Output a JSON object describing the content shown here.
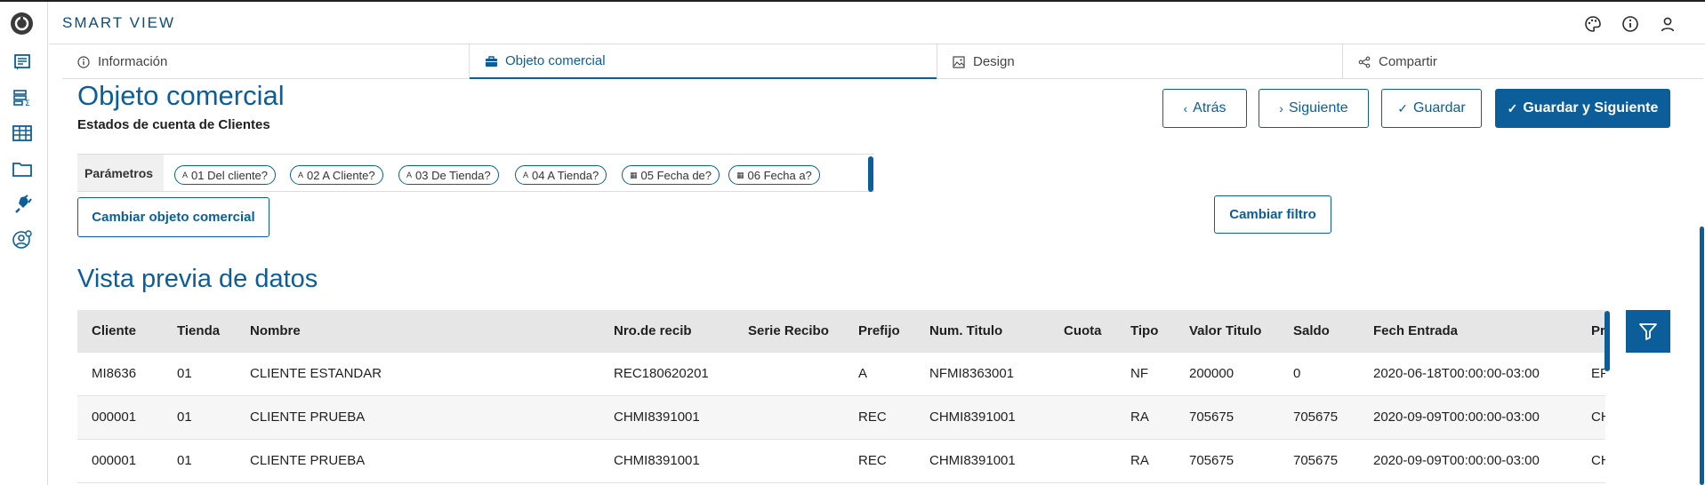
{
  "header": {
    "app_title": "SMART VIEW",
    "icons": [
      "palette-icon",
      "info-icon",
      "user-icon"
    ]
  },
  "sidebar": {
    "icons": [
      "app-logo-icon",
      "report-icon",
      "list-sum-icon",
      "table-icon",
      "folder-icon",
      "plug-icon",
      "user-settings-icon"
    ]
  },
  "tabs": [
    {
      "label": "Información",
      "icon": "info-icon",
      "active": false
    },
    {
      "label": "Objeto comercial",
      "icon": "briefcase-icon",
      "active": true
    },
    {
      "label": "Design",
      "icon": "image-icon",
      "active": false
    },
    {
      "label": "Compartir",
      "icon": "share-icon",
      "active": false
    }
  ],
  "page": {
    "title": "Objeto comercial",
    "subtitle": "Estados de cuenta de Clientes"
  },
  "actions": {
    "back": "Atrás",
    "next": "Siguiente",
    "save": "Guardar",
    "save_next": "Guardar y Siguiente"
  },
  "parameters": {
    "label": "Parámetros",
    "chips": [
      {
        "label": "01 Del cliente?",
        "icon": "A"
      },
      {
        "label": "02 A Cliente?",
        "icon": "A"
      },
      {
        "label": "03 De Tienda?",
        "icon": "A"
      },
      {
        "label": "04 A Tienda?",
        "icon": "A"
      },
      {
        "label": "05 Fecha de?",
        "icon": "calendar"
      },
      {
        "label": "06 Fecha a?",
        "icon": "calendar"
      }
    ]
  },
  "buttons": {
    "change_object": "Cambiar objeto comercial",
    "change_filter": "Cambiar filtro"
  },
  "preview": {
    "title": "Vista previa de datos",
    "columns": [
      "Cliente",
      "Tienda",
      "Nombre",
      "Nro.de recib",
      "Serie Recibo",
      "Prefijo",
      "Num. Titulo",
      "Cuota",
      "Tipo",
      "Valor Titulo",
      "Saldo",
      "Fech Entrada",
      "Pr"
    ],
    "rows": [
      [
        "MI8636",
        "01",
        "CLIENTE ESTANDAR",
        "REC180620201",
        "",
        "A",
        "NFMI8363001",
        "",
        "NF",
        "200000",
        "0",
        "2020-06-18T00:00:00-03:00",
        "EF"
      ],
      [
        "000001",
        "01",
        "CLIENTE PRUEBA",
        "CHMI8391001",
        "",
        "REC",
        "CHMI8391001",
        "",
        "RA",
        "705675",
        "705675",
        "2020-09-09T00:00:00-03:00",
        "CH"
      ],
      [
        "000001",
        "01",
        "CLIENTE PRUEBA",
        "CHMI8391001",
        "",
        "REC",
        "CHMI8391001",
        "",
        "RA",
        "705675",
        "705675",
        "2020-09-09T00:00:00-03:00",
        "CH"
      ]
    ]
  },
  "colors": {
    "primary": "#0b5e99",
    "header_text": "#0b4d7a",
    "table_header_bg": "#e6e6e6"
  }
}
